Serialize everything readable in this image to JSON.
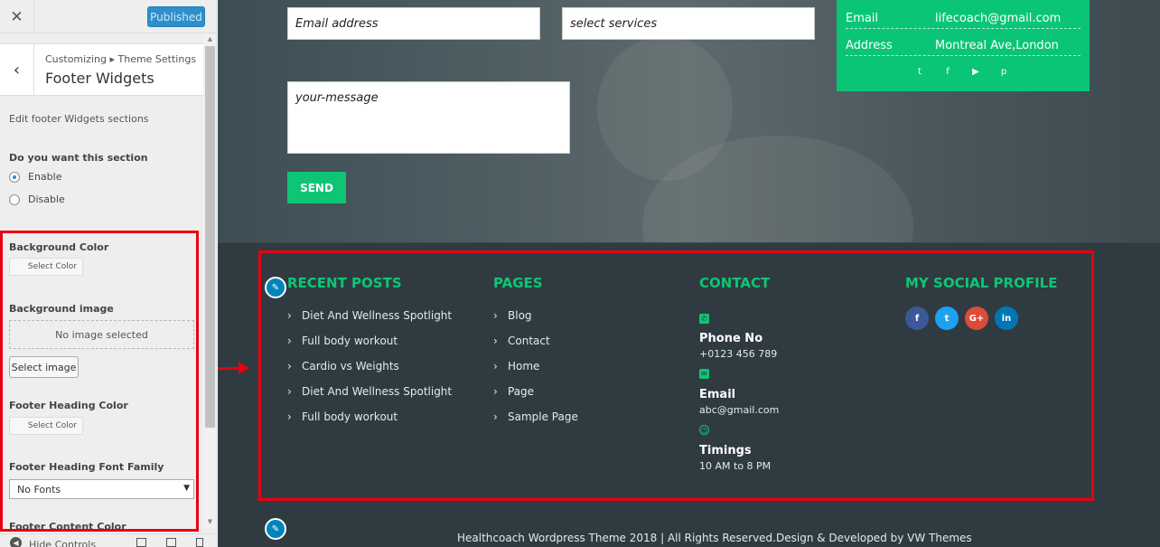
{
  "sidebar": {
    "close_glyph": "✕",
    "published_label": "Published",
    "back_glyph": "‹",
    "breadcrumb": "Customizing ▸ Theme Settings",
    "section_title": "Footer Widgets",
    "description": "Edit footer Widgets sections",
    "toggle": {
      "title": "Do you want this section",
      "options": [
        "Enable",
        "Disable"
      ],
      "selected": "Enable"
    },
    "background_color": {
      "label": "Background Color",
      "button": "Select Color"
    },
    "background_image": {
      "label": "Background image",
      "placeholder": "No image selected",
      "button": "Select image"
    },
    "footer_heading_color": {
      "label": "Footer Heading Color",
      "button": "Select Color"
    },
    "footer_heading_font": {
      "label": "Footer Heading Font Family",
      "value": "No Fonts"
    },
    "next_label_partial": "Footer Content Color",
    "hide_controls": "Hide Controls",
    "scroll_up": "▲",
    "scroll_down": "▼"
  },
  "preview": {
    "form": {
      "email_placeholder": "Email address",
      "services_placeholder": "select services",
      "message_placeholder": "your-message",
      "send_label": "SEND"
    },
    "contact_card": {
      "rows": [
        {
          "key": "Email",
          "value": "lifecoach@gmail.com"
        },
        {
          "key": "Address",
          "value": "Montreal Ave,London"
        }
      ],
      "social_glyphs": [
        "t",
        "f",
        "▶",
        "p"
      ]
    },
    "footer": {
      "recent_posts": {
        "heading": "RECENT POSTS",
        "items": [
          "Diet And Wellness Spotlight",
          "Full body workout",
          "Cardio vs Weights",
          "Diet And Wellness Spotlight",
          "Full body workout"
        ]
      },
      "pages": {
        "heading": "PAGES",
        "items": [
          "Blog",
          "Contact",
          "Home",
          "Page",
          "Sample Page"
        ]
      },
      "contact": {
        "heading": "CONTACT",
        "items": [
          {
            "label": "Phone No",
            "value": "+0123 456 789",
            "icon": "phone-icon"
          },
          {
            "label": "Email",
            "value": "abc@gmail.com",
            "icon": "envelope-icon"
          },
          {
            "label": "Timings",
            "value": "10 AM to 8 PM",
            "icon": "clock-icon"
          }
        ]
      },
      "social": {
        "heading": "MY SOCIAL PROFILE",
        "icons": [
          {
            "glyph": "f",
            "color": "#3b5998"
          },
          {
            "glyph": "t",
            "color": "#1da1f2"
          },
          {
            "glyph": "G+",
            "color": "#dd4b39"
          },
          {
            "glyph": "in",
            "color": "#0077b5"
          }
        ]
      },
      "chevron": "›",
      "copyright": "Healthcoach Wordpress Theme 2018 | All Rights Reserved.Design & Developed by VW Themes"
    },
    "edit_glyph": "✎"
  },
  "colors": {
    "accent_green": "#0fc575",
    "annotation_red": "#e8000f",
    "wp_blue": "#2e8ece",
    "footer_bg": "#2f3b41"
  }
}
